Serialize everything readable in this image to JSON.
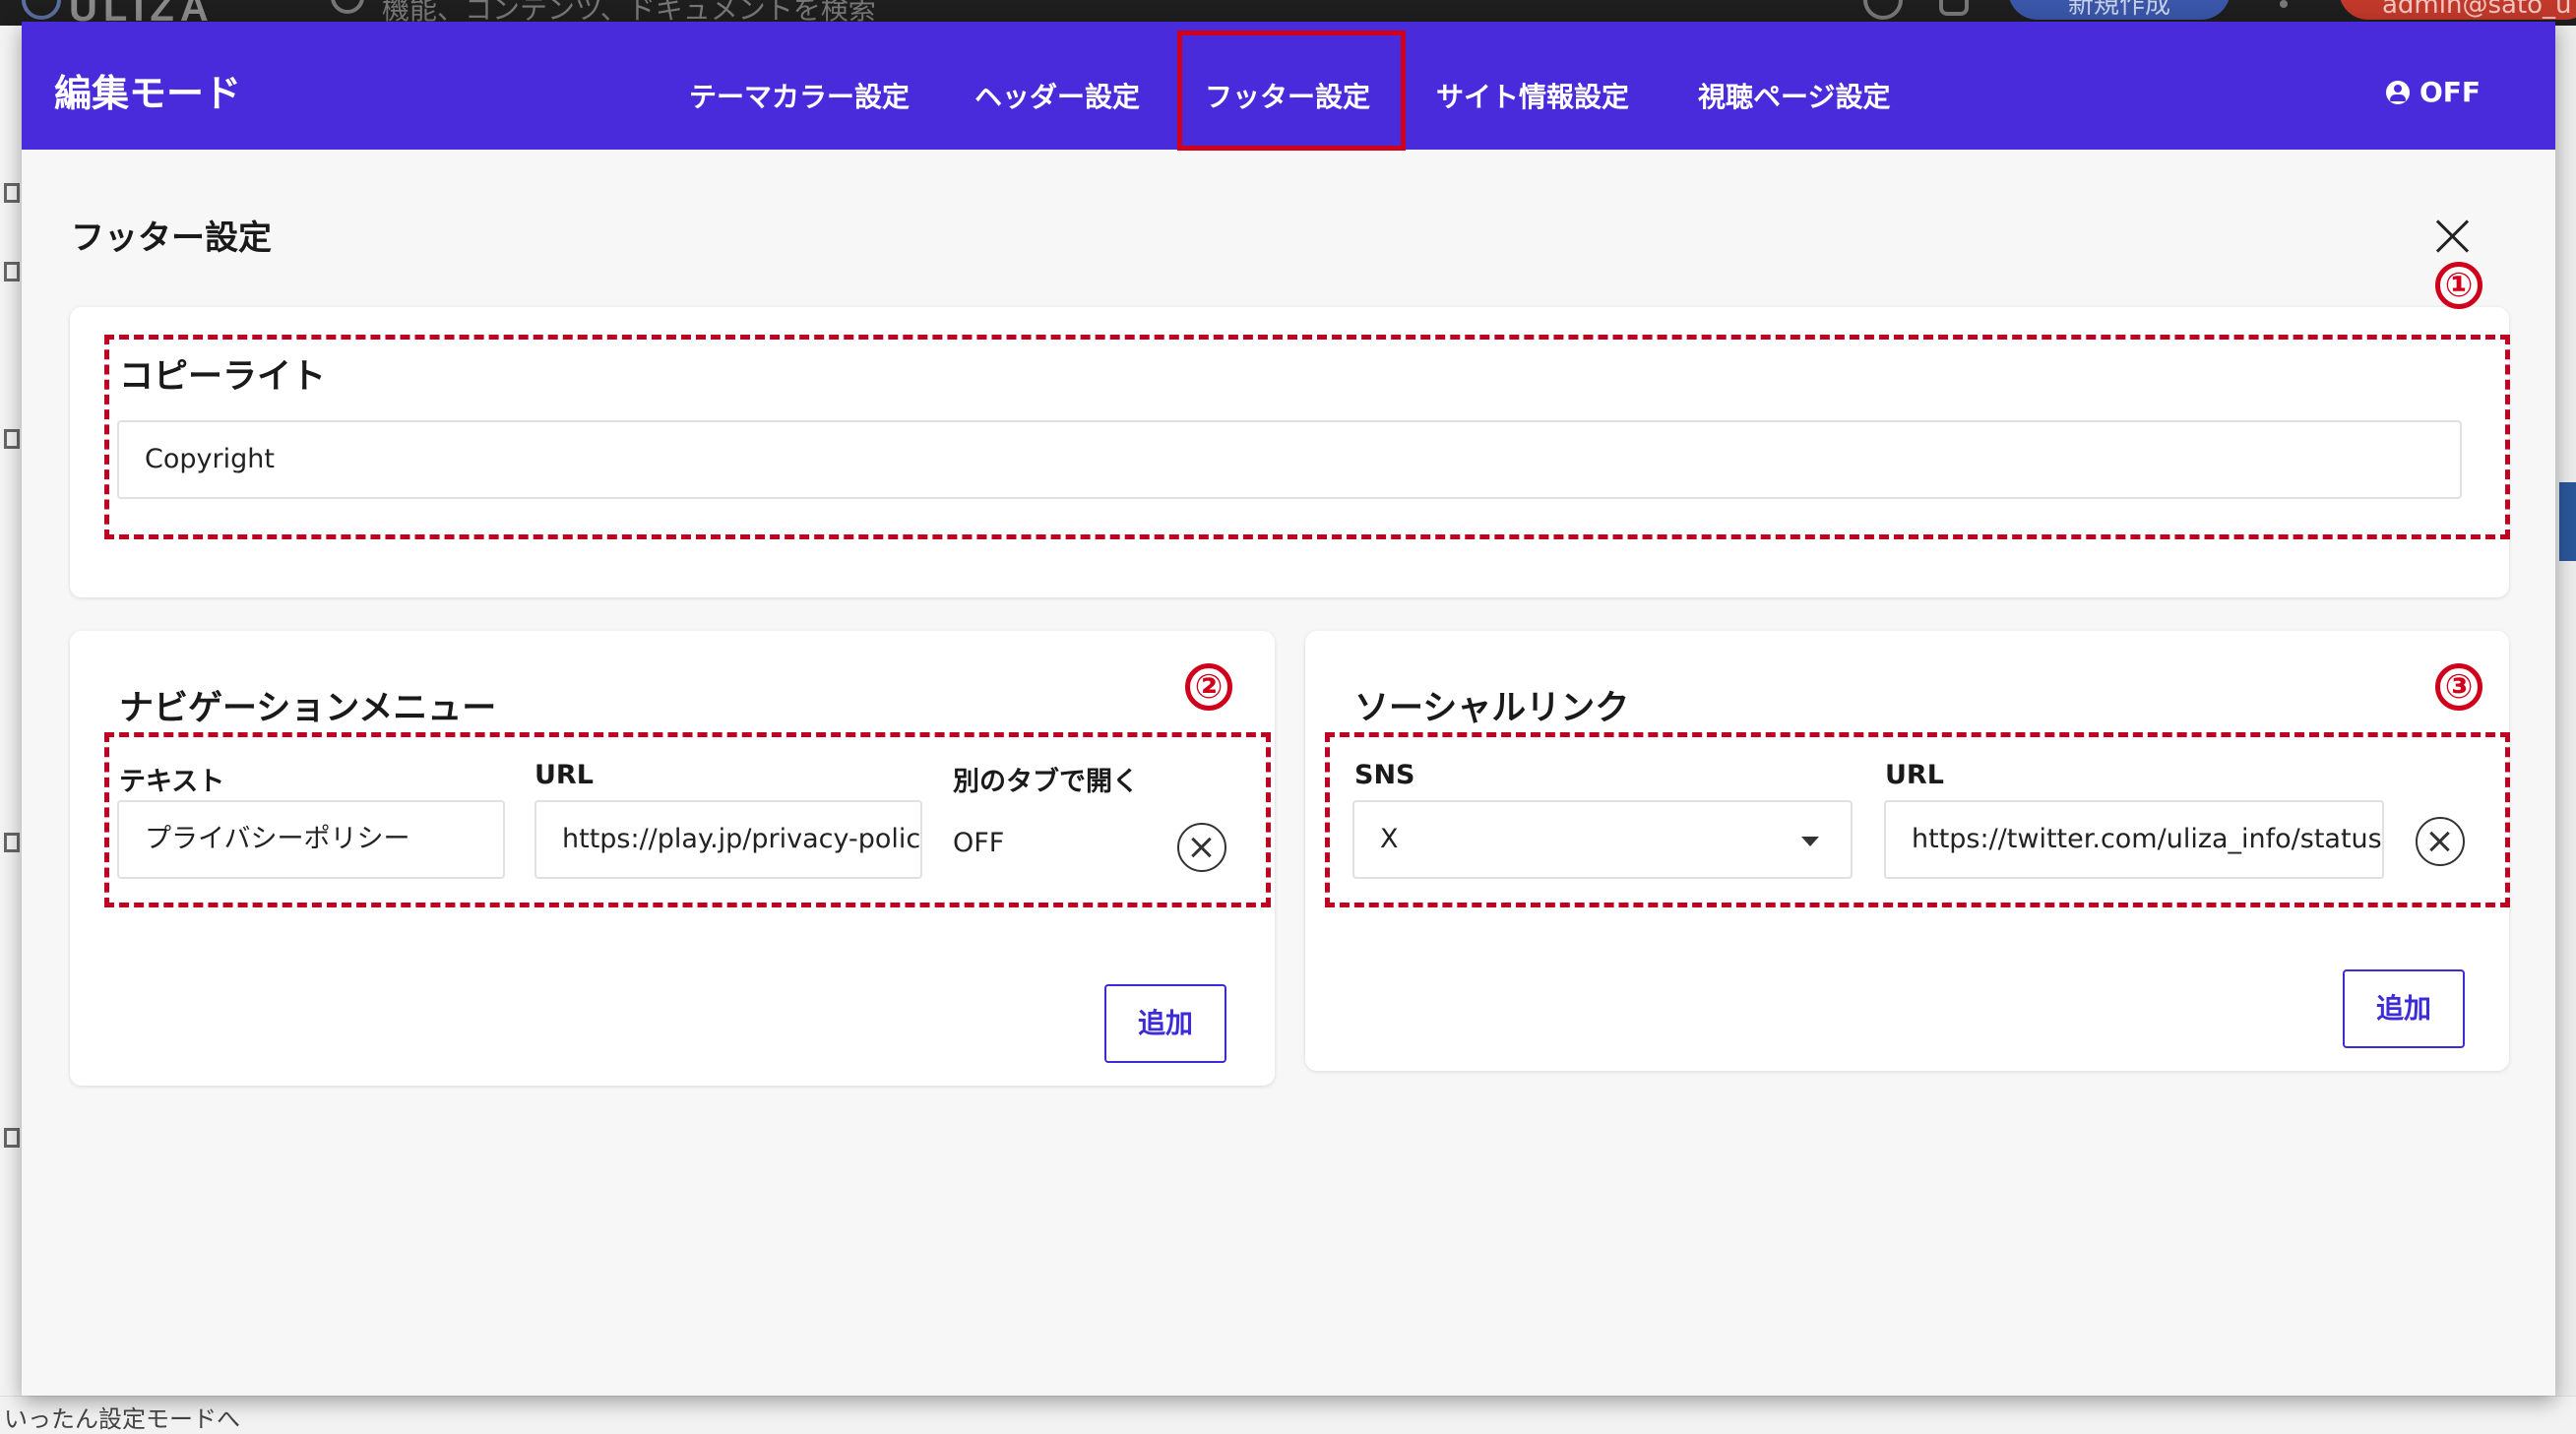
{
  "background": {
    "logo": "ULIZA",
    "search_placeholder": "機能、コンテンツ、ドキュメントを検索",
    "new_button": "新規作成",
    "user": "admin@sato_u",
    "bottom_text": "いったん設定モードへ"
  },
  "header": {
    "title": "編集モード",
    "tabs": [
      {
        "label": "テーマカラー設定"
      },
      {
        "label": "ヘッダー設定"
      },
      {
        "label": "フッター設定",
        "active": true
      },
      {
        "label": "サイト情報設定"
      },
      {
        "label": "視聴ページ設定"
      }
    ],
    "toggle_label": "OFF"
  },
  "page": {
    "title": "フッター設定"
  },
  "copyright": {
    "title": "コピーライト",
    "value": "Copyright"
  },
  "navigation": {
    "title": "ナビゲーションメニュー",
    "col_text": "テキスト",
    "col_url": "URL",
    "col_newtab": "別のタブで開く",
    "rows": [
      {
        "text": "プライバシーポリシー",
        "url": "https://play.jp/privacy-polic",
        "newtab": "OFF"
      }
    ],
    "add_label": "追加"
  },
  "social": {
    "title": "ソーシャルリンク",
    "col_sns": "SNS",
    "col_url": "URL",
    "rows": [
      {
        "sns": "X",
        "url": "https://twitter.com/uliza_info/status"
      }
    ],
    "add_label": "追加"
  },
  "markers": [
    "①",
    "②",
    "③"
  ],
  "colors": {
    "header_bg": "#4a2bdb",
    "accent": "#3d2cd6",
    "annotation_red": "#c00020"
  }
}
